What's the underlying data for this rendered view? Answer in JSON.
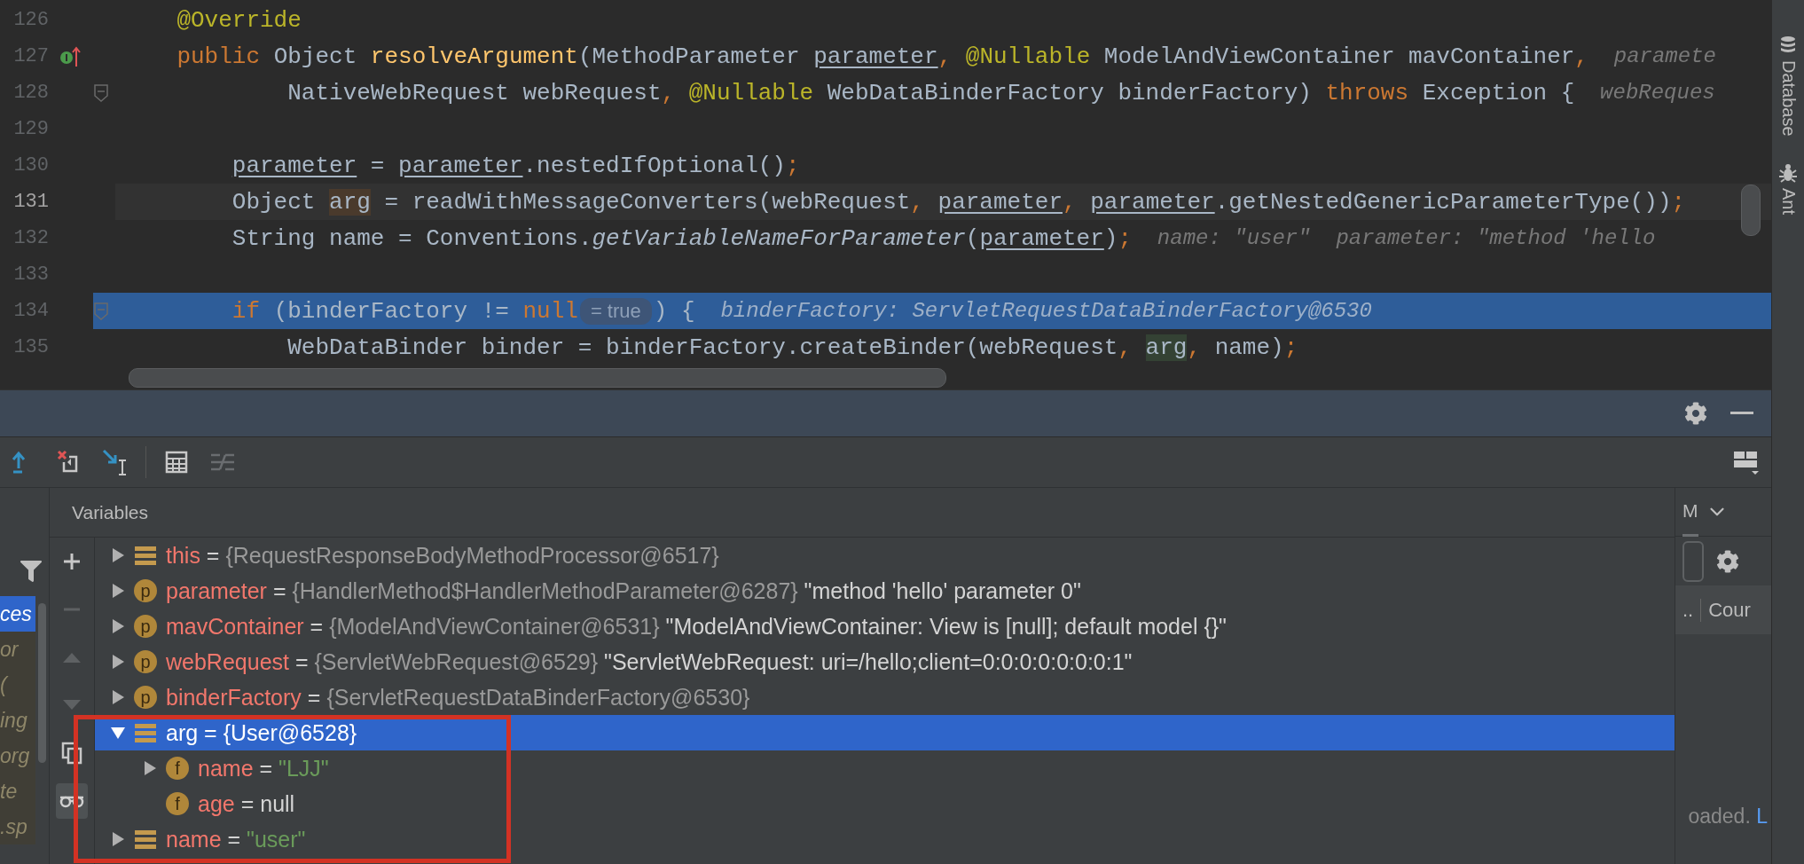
{
  "editor": {
    "lines": [
      {
        "number": "126",
        "kind": "indent1",
        "current": false,
        "highlighted": false,
        "fold": false,
        "tokens": [
          {
            "text": "@Override",
            "kind": "annotation"
          }
        ]
      },
      {
        "number": "127",
        "kind": "indent1",
        "current": false,
        "highlighted": false,
        "fold": false,
        "marker": {
          "kind": "implements"
        },
        "tokens": [
          {
            "text": "public",
            "kind": "keyword"
          },
          {
            "text": " Object ",
            "kind": "plain"
          },
          {
            "text": "resolveArgument",
            "kind": "declaration"
          },
          {
            "text": "(MethodParameter ",
            "kind": "plain"
          },
          {
            "text": "parameter",
            "kind": "parameter"
          },
          {
            "text": ", ",
            "kind": "punct"
          },
          {
            "text": "@Nullable",
            "kind": "annotation"
          },
          {
            "text": " ModelAndViewContainer mavContainer",
            "kind": "plain"
          },
          {
            "text": ",",
            "kind": "punct"
          },
          {
            "text": "paramete",
            "kind": "inlay"
          }
        ]
      },
      {
        "number": "128",
        "kind": "indent3",
        "current": false,
        "highlighted": false,
        "fold": true,
        "tokens": [
          {
            "text": "NativeWebRequest webRequest",
            "kind": "plain"
          },
          {
            "text": ", ",
            "kind": "punct"
          },
          {
            "text": "@Nullable",
            "kind": "annotation"
          },
          {
            "text": " WebDataBinderFactory binderFactory) ",
            "kind": "plain"
          },
          {
            "text": "throws",
            "kind": "keyword"
          },
          {
            "text": " Exception {",
            "kind": "plain"
          },
          {
            "text": "webReques",
            "kind": "inlay"
          }
        ]
      },
      {
        "number": "129",
        "kind": "blank",
        "current": false,
        "highlighted": false,
        "fold": false
      },
      {
        "number": "130",
        "kind": "indent2",
        "current": false,
        "highlighted": false,
        "fold": false,
        "tokens": [
          {
            "text": "parameter",
            "kind": "parameter"
          },
          {
            "text": " = ",
            "kind": "plain"
          },
          {
            "text": "parameter",
            "kind": "parameter"
          },
          {
            "text": ".nestedIfOptional()",
            "kind": "plain"
          },
          {
            "text": ";",
            "kind": "punct"
          }
        ]
      },
      {
        "number": "131",
        "kind": "indent2",
        "current": true,
        "highlighted": false,
        "fold": false,
        "tokens": [
          {
            "text": "Object ",
            "kind": "plain"
          },
          {
            "text": "arg",
            "kind": "usage"
          },
          {
            "text": " = readWithMessageConverters(webRequest",
            "kind": "plain"
          },
          {
            "text": ", ",
            "kind": "punct"
          },
          {
            "text": "parameter",
            "kind": "parameter"
          },
          {
            "text": ", ",
            "kind": "punct"
          },
          {
            "text": "parameter",
            "kind": "parameter"
          },
          {
            "text": ".getNestedGenericParameterType())",
            "kind": "plain"
          },
          {
            "text": ";",
            "kind": "punct"
          }
        ]
      },
      {
        "number": "132",
        "kind": "indent2",
        "current": false,
        "highlighted": false,
        "fold": false,
        "tokens": [
          {
            "text": "String name = Conventions.",
            "kind": "plain"
          },
          {
            "text": "getVariableNameForParameter",
            "kind": "static"
          },
          {
            "text": "(",
            "kind": "plain"
          },
          {
            "text": "parameter",
            "kind": "parameter"
          },
          {
            "text": ")",
            "kind": "plain"
          },
          {
            "text": ";",
            "kind": "punct"
          },
          {
            "text": "name: \"user\"  parameter: \"method 'hello",
            "kind": "inlay"
          }
        ]
      },
      {
        "number": "133",
        "kind": "blank",
        "current": false,
        "highlighted": false,
        "fold": false
      },
      {
        "number": "134",
        "kind": "indent2",
        "current": false,
        "highlighted": true,
        "fold": true,
        "tokens": [
          {
            "text": "if",
            "kind": "keyword"
          },
          {
            "text": " (binderFactory != ",
            "kind": "plain"
          },
          {
            "text": "null",
            "kind": "keyword"
          },
          {
            "text": "= true",
            "kind": "value_badge"
          },
          {
            "text": ") {",
            "kind": "plain"
          },
          {
            "text": "binderFactory: ServletRequestDataBinderFactory@6530",
            "kind": "inlay"
          }
        ]
      },
      {
        "number": "135",
        "kind": "indent3",
        "current": false,
        "highlighted": false,
        "fold": false,
        "tokens": [
          {
            "text": "WebDataBinder binder = binderFactory.createBinder(webRequest",
            "kind": "plain"
          },
          {
            "text": ", ",
            "kind": "punct"
          },
          {
            "text": "arg",
            "kind": "usage_write"
          },
          {
            "text": ", ",
            "kind": "punct"
          },
          {
            "text": "name)",
            "kind": "plain"
          },
          {
            "text": ";",
            "kind": "punct"
          }
        ]
      }
    ]
  },
  "toolbar": [
    {
      "kind": "step_out",
      "disabled": false
    },
    {
      "kind": "drop_frame",
      "disabled": false
    },
    {
      "kind": "run_to_cursor",
      "disabled": false
    },
    {
      "kind": "evaluate",
      "disabled": false
    },
    {
      "kind": "trace",
      "disabled": true
    }
  ],
  "frames": [
    {
      "text": "ces",
      "selected": true
    },
    {
      "text": "or",
      "selected": false
    },
    {
      "text": "(",
      "selected": false
    },
    {
      "text": "ing",
      "selected": false
    },
    {
      "text": "org",
      "selected": false
    },
    {
      "text": "te",
      "selected": false
    },
    {
      "text": ".sp",
      "selected": false
    }
  ],
  "variable_actions": [
    {
      "kind": "add",
      "disabled": false
    },
    {
      "kind": "remove",
      "disabled": true
    },
    {
      "kind": "up",
      "disabled": true
    },
    {
      "kind": "down",
      "disabled": true
    },
    {
      "kind": "copy",
      "disabled": false
    },
    {
      "kind": "glasses",
      "disabled": false
    }
  ],
  "variables": {
    "title": "Variables",
    "rows": [
      {
        "name": "this",
        "kind": "local",
        "expanded": false,
        "selected": false,
        "assign": "=",
        "value": {
          "text": "{RequestResponseBodyMethodProcessor@6517}",
          "kind": "object"
        }
      },
      {
        "name": "parameter",
        "kind": "member",
        "badge": "p",
        "expanded": false,
        "selected": false,
        "assign": "=",
        "value": {
          "text": "{HandlerMethod$HandlerMethodParameter@6287}",
          "kind": "object"
        },
        "description": "\"method 'hello' parameter 0\""
      },
      {
        "name": "mavContainer",
        "kind": "member",
        "badge": "p",
        "expanded": false,
        "selected": false,
        "assign": "=",
        "value": {
          "text": "{ModelAndViewContainer@6531}",
          "kind": "object"
        },
        "description": "\"ModelAndViewContainer: View is [null]; default model {}\""
      },
      {
        "name": "webRequest",
        "kind": "member",
        "badge": "p",
        "expanded": false,
        "selected": false,
        "assign": "=",
        "value": {
          "text": "{ServletWebRequest@6529}",
          "kind": "object"
        },
        "description": "\"ServletWebRequest: uri=/hello;client=0:0:0:0:0:0:0:1\""
      },
      {
        "name": "binderFactory",
        "kind": "member",
        "badge": "p",
        "expanded": false,
        "selected": false,
        "assign": "=",
        "value": {
          "text": "{ServletRequestDataBinderFactory@6530}",
          "kind": "object"
        }
      },
      {
        "name": "arg",
        "kind": "local",
        "expanded": true,
        "selected": true,
        "assign": "=",
        "value": {
          "text": "{User@6528}",
          "kind": "object"
        },
        "children": [
          {
            "name": "name",
            "kind": "member",
            "badge": "f",
            "expanded": false,
            "selected": false,
            "assign": "=",
            "value": {
              "text": "\"LJJ\"",
              "kind": "string"
            }
          },
          {
            "name": "age",
            "kind": "member",
            "badge": "f",
            "selected": false,
            "assign": "=",
            "value": {
              "text": "null",
              "kind": "null"
            }
          }
        ]
      },
      {
        "name": "name",
        "kind": "local",
        "expanded": false,
        "selected": false,
        "assign": "=",
        "value": {
          "text": "\"user\"",
          "kind": "string"
        }
      }
    ]
  },
  "watches": {
    "tab": {
      "label": "M",
      "selected": true
    },
    "columns": [
      "..",
      "Cour"
    ],
    "message": "oaded.",
    "link": "L"
  },
  "tool_strip": [
    {
      "label": "Database",
      "kind": "database"
    },
    {
      "label": "Ant",
      "kind": "ant"
    }
  ]
}
